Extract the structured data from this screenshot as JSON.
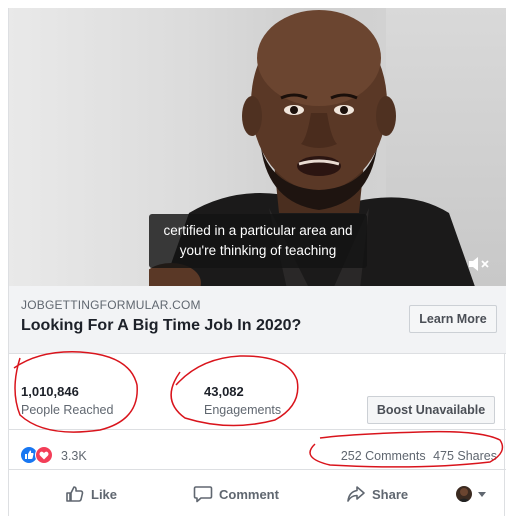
{
  "video": {
    "caption_line1": "certified in a particular area and",
    "caption_line2": "you're thinking of teaching",
    "mute_icon": "speaker-muted-icon"
  },
  "link_preview": {
    "domain": "JOBGETTINGFORMULAR.COM",
    "title": "Looking For A Big Time Job In 2020?",
    "cta_label": "Learn More"
  },
  "insights": {
    "people_reached_value": "1,010,846",
    "people_reached_label": "People Reached",
    "engagements_value": "43,082",
    "engagements_label": "Engagements",
    "boost_label": "Boost Unavailable"
  },
  "reactions": {
    "icons": [
      "like-reaction-icon",
      "love-reaction-icon"
    ],
    "count": "3.3K",
    "comments": "252 Comments",
    "shares": "475 Shares"
  },
  "actions": {
    "like_label": "Like",
    "comment_label": "Comment",
    "share_label": "Share"
  },
  "colors": {
    "facebook_blue": "#1877f2",
    "love_red": "#f33e58",
    "annotation_red": "#d9141c"
  }
}
